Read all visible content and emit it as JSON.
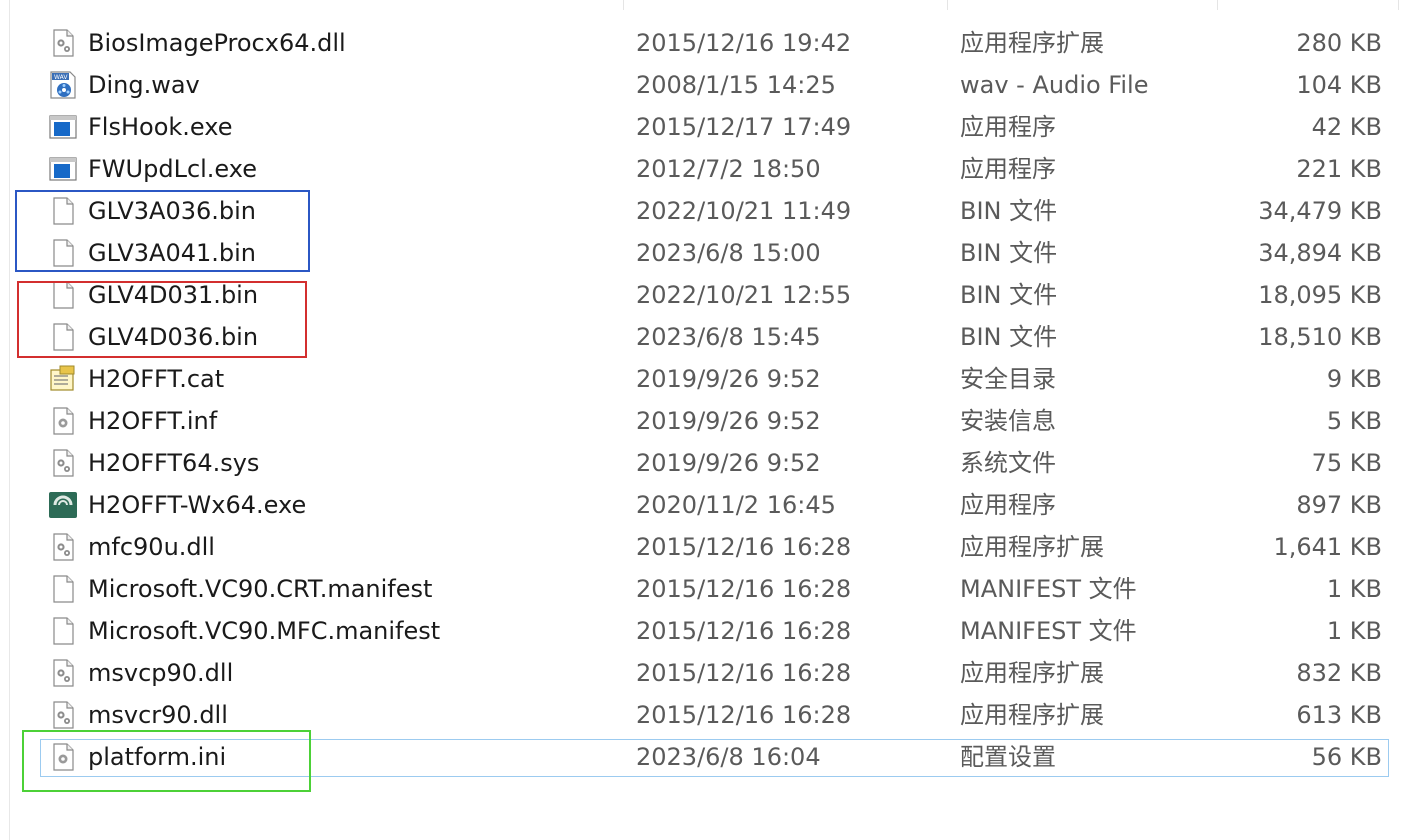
{
  "files": [
    {
      "name": "BiosImageProcx64.dll",
      "date": "2015/12/16 19:42",
      "type": "应用程序扩展",
      "size": "280 KB",
      "icon": "dll-gear-icon"
    },
    {
      "name": "Ding.wav",
      "date": "2008/1/15 14:25",
      "type": "wav - Audio File",
      "size": "104 KB",
      "icon": "wav-audio-icon"
    },
    {
      "name": "FlsHook.exe",
      "date": "2015/12/17 17:49",
      "type": "应用程序",
      "size": "42 KB",
      "icon": "exe-window-icon"
    },
    {
      "name": "FWUpdLcl.exe",
      "date": "2012/7/2 18:50",
      "type": "应用程序",
      "size": "221 KB",
      "icon": "exe-window-icon"
    },
    {
      "name": "GLV3A036.bin",
      "date": "2022/10/21 11:49",
      "type": "BIN 文件",
      "size": "34,479 KB",
      "icon": "blank-file-icon"
    },
    {
      "name": "GLV3A041.bin",
      "date": "2023/6/8 15:00",
      "type": "BIN 文件",
      "size": "34,894 KB",
      "icon": "blank-file-icon"
    },
    {
      "name": "GLV4D031.bin",
      "date": "2022/10/21 12:55",
      "type": "BIN 文件",
      "size": "18,095 KB",
      "icon": "blank-file-icon"
    },
    {
      "name": "GLV4D036.bin",
      "date": "2023/6/8 15:45",
      "type": "BIN 文件",
      "size": "18,510 KB",
      "icon": "blank-file-icon"
    },
    {
      "name": "H2OFFT.cat",
      "date": "2019/9/26 9:52",
      "type": "安全目录",
      "size": "9 KB",
      "icon": "security-catalog-icon"
    },
    {
      "name": "H2OFFT.inf",
      "date": "2019/9/26 9:52",
      "type": "安装信息",
      "size": "5 KB",
      "icon": "settings-file-icon"
    },
    {
      "name": "H2OFFT64.sys",
      "date": "2019/9/26 9:52",
      "type": "系统文件",
      "size": "75 KB",
      "icon": "dll-gear-icon"
    },
    {
      "name": "H2OFFT-Wx64.exe",
      "date": "2020/11/2 16:45",
      "type": "应用程序",
      "size": "897 KB",
      "icon": "insyde-app-icon"
    },
    {
      "name": "mfc90u.dll",
      "date": "2015/12/16 16:28",
      "type": "应用程序扩展",
      "size": "1,641 KB",
      "icon": "dll-gear-icon"
    },
    {
      "name": "Microsoft.VC90.CRT.manifest",
      "date": "2015/12/16 16:28",
      "type": "MANIFEST 文件",
      "size": "1 KB",
      "icon": "blank-file-icon"
    },
    {
      "name": "Microsoft.VC90.MFC.manifest",
      "date": "2015/12/16 16:28",
      "type": "MANIFEST 文件",
      "size": "1 KB",
      "icon": "blank-file-icon"
    },
    {
      "name": "msvcp90.dll",
      "date": "2015/12/16 16:28",
      "type": "应用程序扩展",
      "size": "832 KB",
      "icon": "dll-gear-icon"
    },
    {
      "name": "msvcr90.dll",
      "date": "2015/12/16 16:28",
      "type": "应用程序扩展",
      "size": "613 KB",
      "icon": "dll-gear-icon"
    },
    {
      "name": "platform.ini",
      "date": "2023/6/8 16:04",
      "type": "配置设置",
      "size": "56 KB",
      "icon": "settings-file-icon",
      "focused": true
    }
  ],
  "colors": {
    "blue_box": "#2b57c4",
    "red_box": "#d32f2f",
    "green_box": "#4cd137",
    "focus_outline": "#9ccbf0"
  }
}
